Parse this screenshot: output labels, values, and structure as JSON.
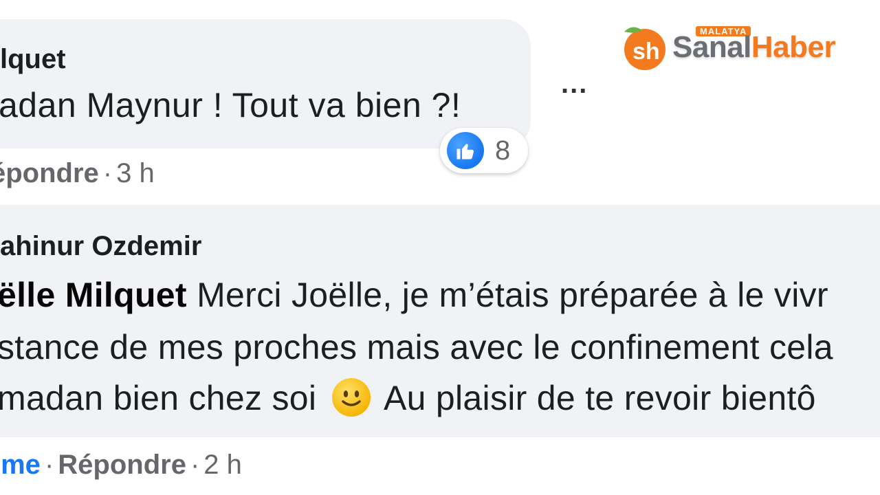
{
  "watermark": {
    "small_label": "MALATYA",
    "brand_part1": "Sanal",
    "brand_part2": "Haber",
    "colors": {
      "orange": "#f47a20",
      "gray": "#6b6e74",
      "leaf": "#6ab04c"
    }
  },
  "comment1": {
    "author": "lquet",
    "text": "adan Maynur ! Tout va bien ?!",
    "more_label": "...",
    "reaction": {
      "icon": "like-icon",
      "count": "8"
    },
    "actions": {
      "reply": "épondre",
      "separator": "·",
      "time": "3 h"
    }
  },
  "comment2": {
    "author": "ahinur Ozdemir",
    "line1": {
      "mention": "ëlle Milquet",
      "text": " Merci Joëlle, je m’étais préparée à le vivr"
    },
    "line2": "stance de mes proches mais avec le confinement cela",
    "line3": {
      "before": "madan bien chez soi",
      "after": "Au plaisir de te revoir bientô"
    },
    "emoji": "smiley-icon",
    "actions": {
      "like": "ime",
      "separator": "·",
      "reply": "Répondre",
      "time": "2 h"
    }
  },
  "colors": {
    "bubble": "#f0f2f5",
    "secondary_text": "#65676b",
    "link_blue": "#1877f2"
  }
}
